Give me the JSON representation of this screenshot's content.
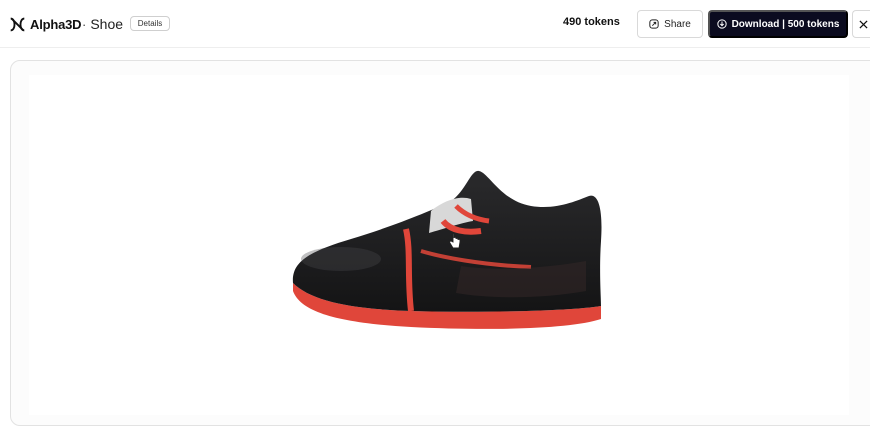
{
  "app": {
    "name": "Alpha3D"
  },
  "header": {
    "separator": "·",
    "model_title": "Shoe",
    "details_label": "Details",
    "tokens_label": "490 tokens",
    "share_label": "Share",
    "download_label": "Download | 500 tokens"
  },
  "icons": {
    "logo": "alpha3d-logo-icon",
    "share": "share-icon",
    "download": "download-icon",
    "close": "close-icon",
    "cursor": "hand-cursor-icon"
  },
  "colors": {
    "primary_button": "#0b0b1f",
    "shoe_body": "#1a1a1c",
    "shoe_accent": "#e0463a"
  }
}
